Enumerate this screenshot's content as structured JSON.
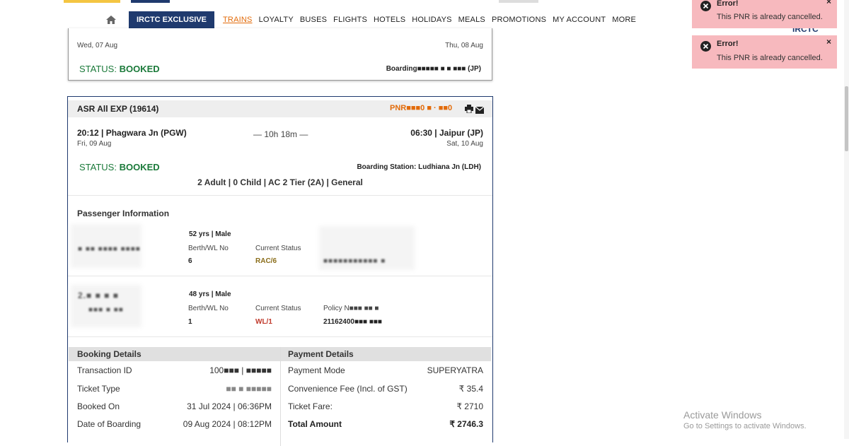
{
  "nav": {
    "exclusive": "IRCTC EXCLUSIVE",
    "items": [
      "TRAINS",
      "LOYALTY",
      "BUSES",
      "FLIGHTS",
      "HOTELS",
      "HOLIDAYS",
      "MEALS",
      "PROMOTIONS",
      "MY ACCOUNT",
      "MORE"
    ],
    "active": "TRAINS"
  },
  "logo_text": "IRCTC",
  "booking1": {
    "dep_date": "Wed, 07 Aug",
    "arr_date": "Thu, 08 Aug",
    "status_label": "STATUS:",
    "status_value": "BOOKED",
    "boarding": "Boarding■■■■■ ■ ■ ■■■ (JP)"
  },
  "booking2": {
    "train": "ASR All EXP (19614)",
    "pnr": "PNR■■■0 ■ · ■■0",
    "dep_time_station": "20:12 | Phagwara Jn (PGW)",
    "dep_date": "Fri, 09 Aug",
    "duration": "— 10h 18m —",
    "arr_time_station": "06:30 | Jaipur (JP)",
    "arr_date": "Sat, 10 Aug",
    "status_label": "STATUS:",
    "status_value": "BOOKED",
    "boarding_station": "Boarding Station: Ludhiana Jn (LDH)",
    "summary": "2 Adult | 0 Child | AC 2 Tier (2A) | General",
    "passenger_section": "Passenger Information",
    "passengers": [
      {
        "age_gender": "52 yrs | Male",
        "berth_label": "Berth/WL No",
        "berth": "6",
        "status_label": "Current Status",
        "status": "RAC/6"
      },
      {
        "age_gender": "48 yrs | Male",
        "berth_label": "Berth/WL No",
        "berth": "1",
        "status_label": "Current Status",
        "status": "WL/1",
        "policy_label": "Policy N■■■ ■■ ■",
        "policy": "21162400■■■ ■■■"
      }
    ],
    "booking_details": {
      "title": "Booking Details",
      "rows": [
        {
          "label": "Transaction ID",
          "value": "100■■■ | ■■■■■"
        },
        {
          "label": "Ticket Type",
          "value": "■■ ■ ■■■■■"
        },
        {
          "label": "Booked On",
          "value": "31 Jul 2024 | 06:36PM"
        },
        {
          "label": "Date of Boarding",
          "value": "09 Aug 2024 | 08:12PM"
        }
      ]
    },
    "payment_details": {
      "title": "Payment Details",
      "rows": [
        {
          "label": "Payment Mode",
          "value": "SUPERYATRA"
        },
        {
          "label": "Convenience Fee (Incl. of GST)",
          "value": "₹ 35.4"
        },
        {
          "label": "Ticket Fare:",
          "value": "₹ 2710"
        },
        {
          "label": "Total Amount",
          "value": "₹ 2746.3"
        }
      ]
    }
  },
  "toasts": [
    {
      "title": "Error!",
      "message": "This PNR is already cancelled.",
      "close": "×"
    },
    {
      "title": "Error!",
      "message": "This PNR is already cancelled.",
      "close": "×"
    }
  ],
  "watermark": {
    "line1": "Activate Windows",
    "line2": "Go to Settings to activate Windows."
  },
  "colors": {
    "brand": "#1f3a6e",
    "accent": "#e26b0a",
    "booked": "#1b7a3a",
    "error_toast": "#f7b9be"
  }
}
